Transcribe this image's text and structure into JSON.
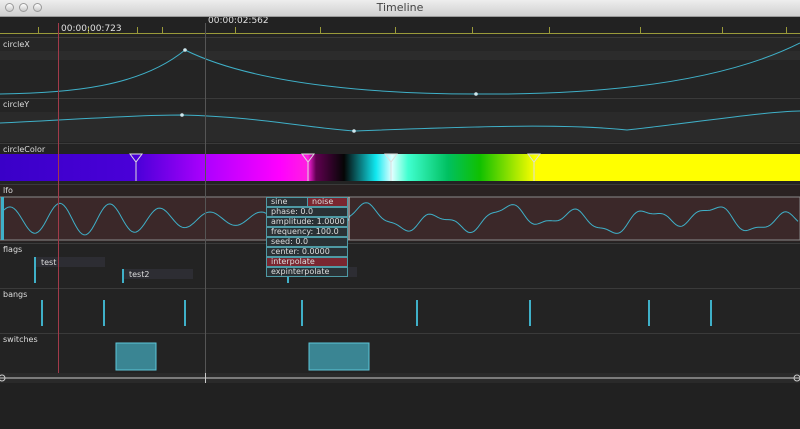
{
  "window": {
    "title": "Timeline"
  },
  "ruler": {
    "playhead_time": "00:00:00:723",
    "hover_time": "00:00:02:562"
  },
  "tracks": [
    {
      "name": "circleX"
    },
    {
      "name": "circleY"
    },
    {
      "name": "circleColor"
    },
    {
      "name": "lfo"
    },
    {
      "name": "flags"
    },
    {
      "name": "bangs"
    },
    {
      "name": "switches"
    }
  ],
  "flags": [
    "test",
    "test2"
  ],
  "lfo_menu": {
    "sine": "sine",
    "noise": "noise",
    "phase": "phase: 0.0",
    "amplitude": "amplitude: 1.0000",
    "frequency": "frequency: 100.0",
    "seed": "seed: 0.0",
    "center": "center: 0.0000",
    "interpolate": "interpolate",
    "expinterpolate": "expinterpolate"
  },
  "colors": {
    "accent": "#3fb0c8",
    "playhead": "#a23a4a",
    "lfo_bg": "#3b2829",
    "menu_red": "#7a2630",
    "switch_fill": "#3a8593"
  }
}
